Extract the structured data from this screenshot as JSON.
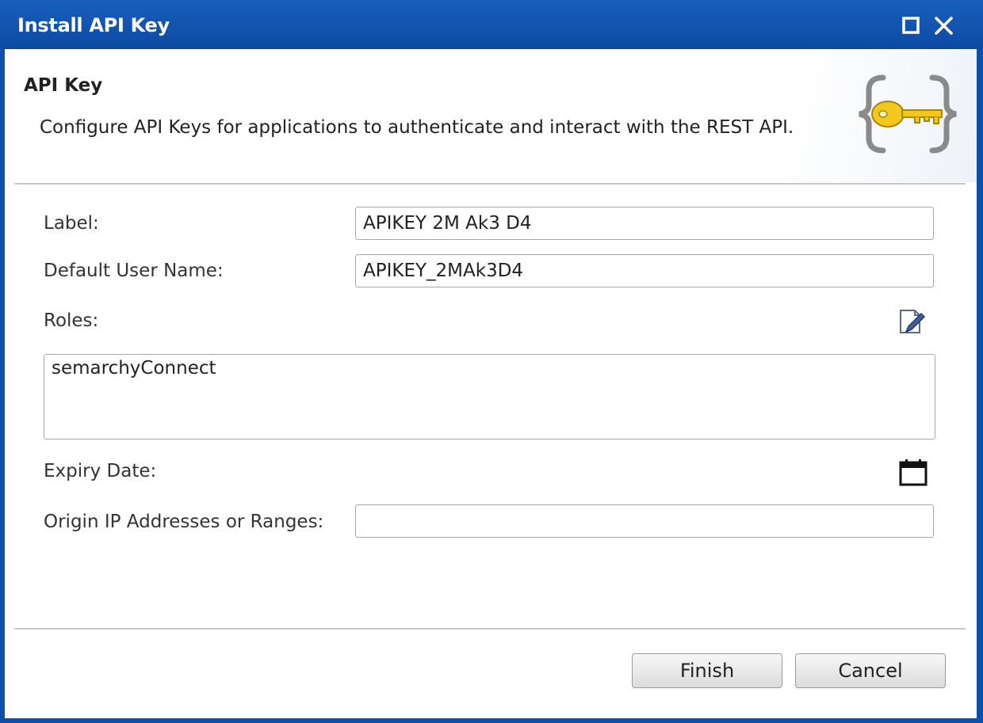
{
  "window": {
    "title": "Install API Key",
    "maximize_icon": "maximize-icon",
    "close_icon": "close-icon"
  },
  "header": {
    "title": "API Key",
    "description": "Configure API Keys for applications to authenticate and interact with the REST API.",
    "icon": "api-key-icon"
  },
  "form": {
    "label": {
      "label": "Label:",
      "value": "APIKEY 2M Ak3 D4"
    },
    "default_user_name": {
      "label": "Default User Name:",
      "value": "APIKEY_2MAk3D4"
    },
    "roles": {
      "label": "Roles:",
      "value": "semarchyConnect",
      "edit_icon": "edit-icon"
    },
    "expiry_date": {
      "label": "Expiry Date:",
      "calendar_icon": "calendar-icon"
    },
    "origin_ip": {
      "label": "Origin IP Addresses or Ranges:",
      "value": ""
    }
  },
  "buttons": {
    "finish": "Finish",
    "cancel": "Cancel"
  },
  "colors": {
    "titlebar": "#0b4aa2",
    "title_text": "#ffffff"
  }
}
